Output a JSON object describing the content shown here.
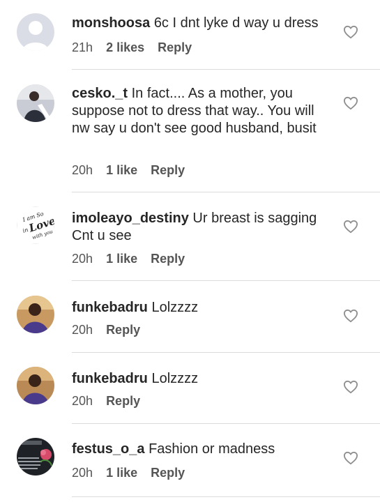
{
  "comments": [
    {
      "username": "monshoosa",
      "text": "6c I dnt lyke d way u dress",
      "time": "21h",
      "likes": "2 likes",
      "reply": "Reply",
      "avatar": "default-avatar-icon"
    },
    {
      "username": "cesko._t",
      "text": "In fact.... As a mother, you suppose not to dress that way.. You will nw say u don't see good husband, busit",
      "time": "20h",
      "likes": "1 like",
      "reply": "Reply",
      "avatar": "photo-avatar"
    },
    {
      "username": "imoleayo_destiny",
      "text": "Ur breast is sagging Cnt u see",
      "time": "20h",
      "likes": "1 like",
      "reply": "Reply",
      "avatar": "love-text-avatar"
    },
    {
      "username": "funkebadru",
      "text": "Lolzzzz",
      "time": "20h",
      "likes": "",
      "reply": "Reply",
      "avatar": "photo-avatar"
    },
    {
      "username": "funkebadru",
      "text": "Lolzzzz",
      "time": "20h",
      "likes": "",
      "reply": "Reply",
      "avatar": "photo-avatar"
    },
    {
      "username": "festus_o_a",
      "text": "Fashion or madness",
      "time": "20h",
      "likes": "1 like",
      "reply": "Reply",
      "avatar": "photo-avatar"
    }
  ],
  "colors": {
    "text": "#262626",
    "meta": "#555555",
    "divider": "#dbdbdb",
    "heart": "#8e8e8e"
  },
  "icons": {
    "like": "heart-outline-icon"
  }
}
